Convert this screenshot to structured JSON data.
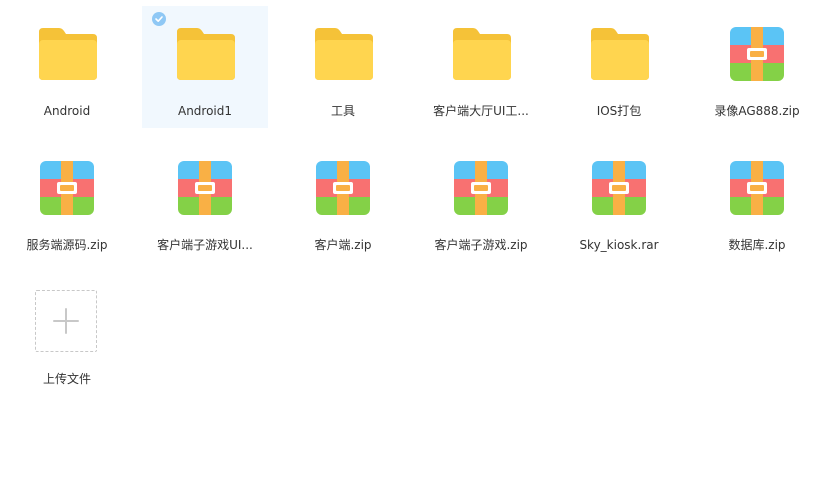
{
  "files": [
    {
      "name": "Android",
      "type": "folder",
      "icon": "folder-icon"
    },
    {
      "name": "Android1",
      "type": "folder",
      "icon": "folder-icon",
      "selected": true
    },
    {
      "name": "工具",
      "type": "folder",
      "icon": "folder-icon"
    },
    {
      "name": "客户端大厅UI工...",
      "type": "folder",
      "icon": "folder-icon"
    },
    {
      "name": "IOS打包",
      "type": "folder",
      "icon": "folder-icon"
    },
    {
      "name": "录像AG888.zip",
      "type": "archive",
      "icon": "archive-icon"
    },
    {
      "name": "服务端源码.zip",
      "type": "archive",
      "icon": "archive-icon"
    },
    {
      "name": "客户端子游戏UI...",
      "type": "archive",
      "icon": "archive-icon"
    },
    {
      "name": "客户端.zip",
      "type": "archive",
      "icon": "archive-icon"
    },
    {
      "name": "客户端子游戏.zip",
      "type": "archive",
      "icon": "archive-icon"
    },
    {
      "name": "Sky_kiosk.rar",
      "type": "archive",
      "icon": "archive-icon"
    },
    {
      "name": "数据库.zip",
      "type": "archive",
      "icon": "archive-icon"
    }
  ],
  "upload": {
    "label": "上传文件",
    "icon": "plus-icon"
  },
  "colors": {
    "folder": "#ffd24d",
    "folder_tab": "#f5c238",
    "archive_blue": "#5bc4f5",
    "archive_red": "#f87171",
    "archive_green": "#84d147",
    "archive_strap": "#f9b045",
    "selected_bg": "#f1f8fe",
    "check": "#8fc8f5"
  }
}
